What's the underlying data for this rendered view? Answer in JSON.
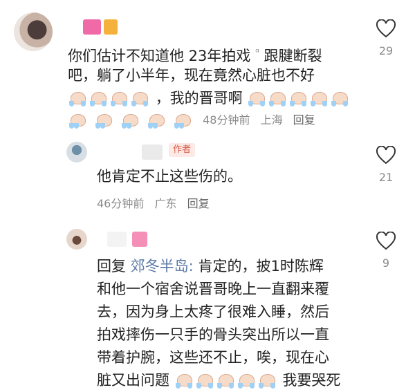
{
  "comments": [
    {
      "text_line1": "你们估计不知道他 23年拍戏",
      "text_line1b": "跟腱断裂",
      "text_line2": "吧，躺了小半年，现在竟然心脏也不好",
      "text_line3_tail": "，我的晋哥啊",
      "time": "48分钟前",
      "location": "上海",
      "reply_label": "回复",
      "likes": "29",
      "colors": {
        "name_block_1": "#f06aa8",
        "name_block_2": "#f4b23c"
      }
    },
    {
      "author_tag": "作者",
      "text": "他肯定不止这些伤的。",
      "time": "46分钟前",
      "location": "广东",
      "reply_label": "回复",
      "likes": "21"
    },
    {
      "reply_prefix": "回复",
      "reply_to": "郊冬半岛:",
      "text_line1_tail": "肯定的，披1时陈辉",
      "text_line2": "和他一个宿舍说晋哥晚上一直翻来覆",
      "text_line3": "去，因为身上太疼了很难入睡，然后",
      "text_line4": "拍戏摔伤一只手的骨头突出所以一直",
      "text_line5": "带着护腕，这些还不止，唉，现在心",
      "text_line6_head": "脏又出问题",
      "text_line6_tail": "我要哭死",
      "likes": "9",
      "colors": {
        "name_block_1": "#f48fb8"
      }
    }
  ],
  "icons": {
    "like": "heart-outline-icon",
    "emoji": "crying-face-emoji",
    "mention": "at-icon"
  },
  "colors": {
    "text": "#222222",
    "meta": "#8a8a8a",
    "author_tag": "#d65b4a",
    "reply_target": "#5b7aa6"
  }
}
